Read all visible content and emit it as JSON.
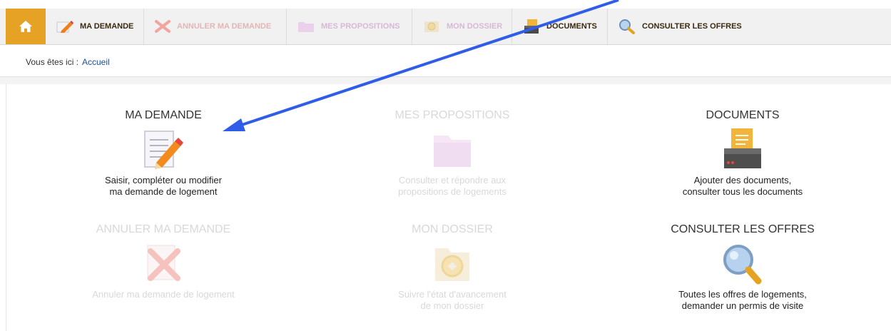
{
  "nav": {
    "home_icon": "home-icon",
    "items": [
      {
        "label": "MA DEMANDE",
        "icon": "pencil-icon"
      },
      {
        "label": "ANNULER MA DEMANDE",
        "icon": "cancel-x-icon"
      },
      {
        "label": "MES PROPOSITIONS",
        "icon": "folder-icon"
      },
      {
        "label": "MON DOSSIER",
        "icon": "dossier-icon"
      },
      {
        "label": "DOCUMENTS",
        "icon": "documents-icon"
      },
      {
        "label": "CONSULTER LES OFFRES",
        "icon": "magnifier-icon"
      }
    ]
  },
  "breadcrumb": {
    "label": "Vous êtes ici :",
    "link": "Accueil"
  },
  "tiles": [
    {
      "title": "MA DEMANDE",
      "line1": "Saisir, compléter ou modifier",
      "line2": "ma demande de logement",
      "enabled": true
    },
    {
      "title": "MES PROPOSITIONS",
      "line1": "Consulter et répondre aux",
      "line2": "propositions de logements",
      "enabled": false
    },
    {
      "title": "DOCUMENTS",
      "line1": "Ajouter des documents,",
      "line2": "consulter tous les documents",
      "enabled": true
    },
    {
      "title": "ANNULER MA DEMANDE",
      "line1": "Annuler ma demande de logement",
      "line2": "",
      "enabled": false
    },
    {
      "title": "MON DOSSIER",
      "line1": "Suivre l'état d'avancement",
      "line2": "de mon dossier",
      "enabled": false
    },
    {
      "title": "CONSULTER LES OFFRES",
      "line1": "Toutes les offres de logements,",
      "line2": "demander un permis de visite",
      "enabled": true
    }
  ],
  "colors": {
    "accent": "#e6a224",
    "arrow": "#2f5de8"
  }
}
